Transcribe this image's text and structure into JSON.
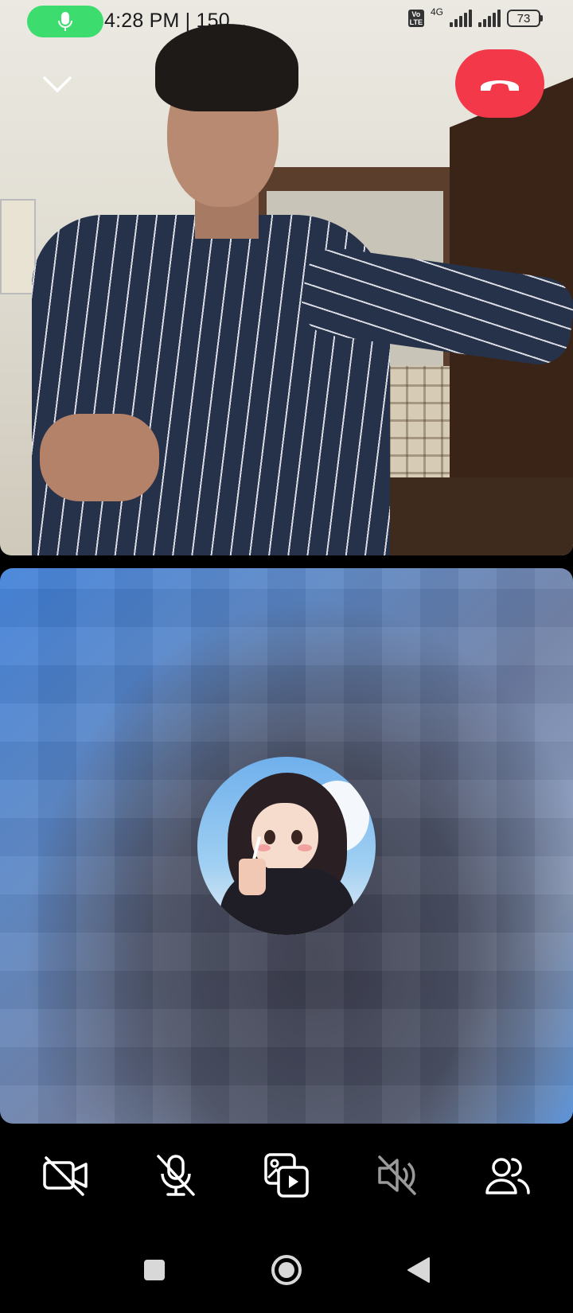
{
  "status_bar": {
    "time": "4:28 PM | 150...",
    "volte": "Vo LTE",
    "network": "4G",
    "battery": "73",
    "mic_active_color": "#3ddc6f"
  },
  "call": {
    "collapse_icon": "chevron-down-icon",
    "end_call_icon": "phone-hangup-icon",
    "end_call_color": "#f3384a"
  },
  "controls": [
    {
      "name": "camera-off-button",
      "icon": "video-off-icon"
    },
    {
      "name": "mic-off-button",
      "icon": "mic-off-icon"
    },
    {
      "name": "share-media-button",
      "icon": "media-share-icon"
    },
    {
      "name": "speaker-off-button",
      "icon": "speaker-off-icon"
    },
    {
      "name": "participants-button",
      "icon": "people-icon"
    }
  ],
  "nav": {
    "recents_icon": "square-icon",
    "home_icon": "circle-icon",
    "back_icon": "triangle-back-icon"
  }
}
